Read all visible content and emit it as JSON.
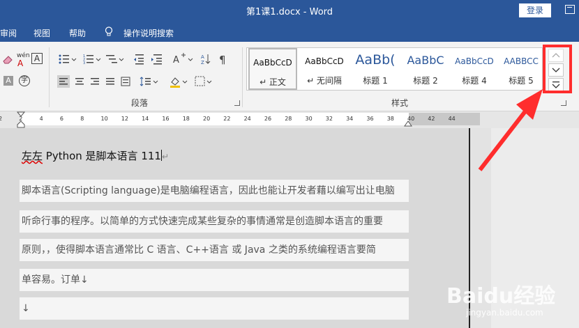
{
  "titlebar": {
    "title": "第1课1.docx  -  Word",
    "login": "登录"
  },
  "tabs": {
    "review": "审阅",
    "view": "视图",
    "help": "帮助",
    "tell_me": "操作说明搜索"
  },
  "ribbon": {
    "phonetic_label": "wén",
    "phonetic_char": "A",
    "paragraph_group": "段落",
    "styles_group": "样式",
    "styles": [
      {
        "sample": "AaBbCcD",
        "name": "↵ 正文"
      },
      {
        "sample": "AaBbCcD",
        "name": "↵ 无间隔"
      },
      {
        "sample": "AaBb(",
        "name": "标题 1"
      },
      {
        "sample": "AaBbC",
        "name": "标题 2"
      },
      {
        "sample": "AaBbCcD",
        "name": "标题 4"
      },
      {
        "sample": "AABBCC",
        "name": "标题 5"
      }
    ]
  },
  "ruler": {
    "ticks": [
      "2",
      "2",
      "4",
      "6",
      "8",
      "10",
      "12",
      "14",
      "16",
      "18",
      "20",
      "22",
      "24",
      "26",
      "28",
      "30",
      "32",
      "34",
      "36",
      "38",
      "40",
      "42",
      "44"
    ]
  },
  "document": {
    "heading_prefix": "左左",
    "heading_rest": " Python 是脚本语言 111",
    "heading_mark": "↵",
    "lines": [
      "脚本语言(Scripting language)是电脑编程语言，因此也能让开发者藉以编写出让电脑",
      "听命行事的程序。以简单的方式快速完成某些复杂的事情通常是创造脚本语言的重要",
      "原则，，使得脚本语言通常比 C 语言、C++语言 或 Java 之类的系统编程语言要简",
      "单容易。订单↓",
      "↓"
    ]
  },
  "watermark": {
    "brand": "Baidu经验",
    "url": "jingyan.baidu.com"
  },
  "colors": {
    "accent": "#2b579a",
    "highlight": "#ff2d2d"
  }
}
